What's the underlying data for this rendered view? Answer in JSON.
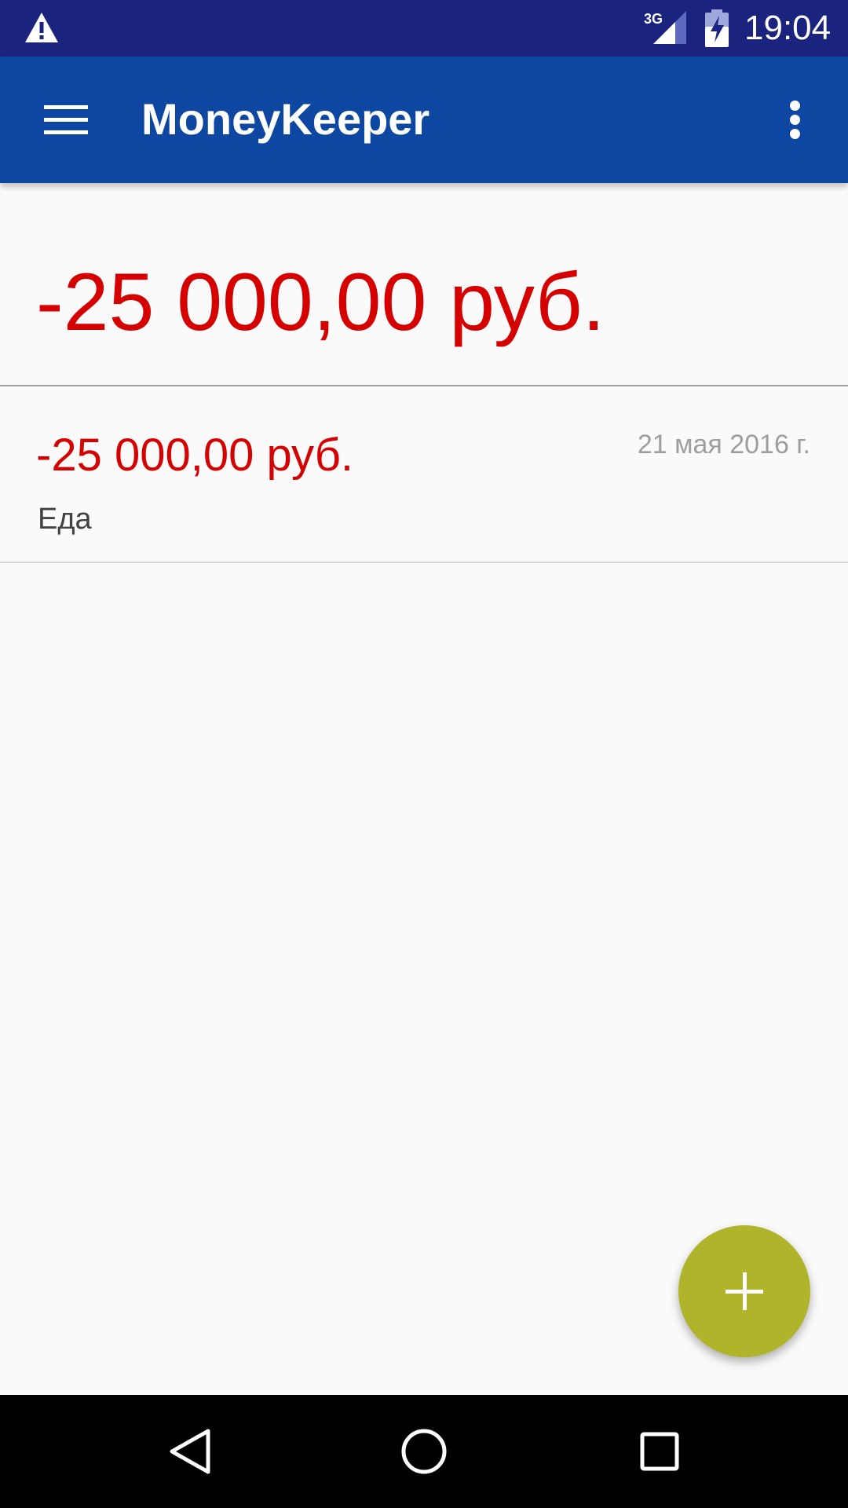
{
  "status_bar": {
    "time": "19:04",
    "network": "3G",
    "icons": [
      "warning-icon",
      "signal-3g-icon",
      "battery-charging-icon"
    ]
  },
  "app_bar": {
    "title": "MoneyKeeper",
    "menu_icon": "hamburger-menu-icon",
    "overflow_icon": "more-vert-icon",
    "background": "#0d47a1"
  },
  "summary": {
    "total": "-25 000,00 руб."
  },
  "transactions": [
    {
      "amount": "-25 000,00 руб.",
      "date": "21 мая 2016 г.",
      "category": "Еда"
    }
  ],
  "fab": {
    "icon": "plus-icon",
    "color": "#afb42b"
  },
  "navigation": {
    "icons": [
      "back-icon",
      "home-icon",
      "recents-icon"
    ]
  },
  "colors": {
    "status_bar": "#1a237e",
    "negative_amount": "#d50000",
    "date_text": "#9e9e9e"
  }
}
